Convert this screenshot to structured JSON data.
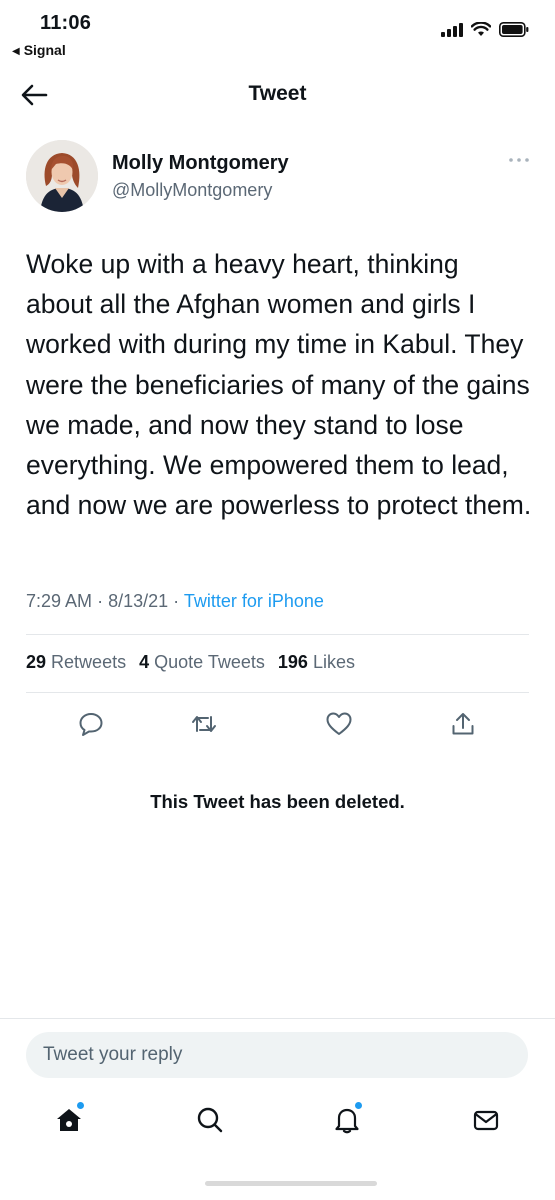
{
  "status_bar": {
    "time": "11:06",
    "back_app_label": "Signal"
  },
  "header": {
    "title": "Tweet"
  },
  "tweet": {
    "author_name": "Molly Montgomery",
    "author_handle": "@MollyMontgomery",
    "text": "Woke up with a heavy heart, thinking about all the Afghan women and girls I worked with during my time in Kabul. They were the beneficiaries of many of the gains we made, and now they stand to lose everything. We empowered them to lead, and now we are powerless to protect them.",
    "time": "7:29 AM",
    "date": "8/13/21",
    "source": "Twitter for iPhone",
    "retweets_count": "29",
    "retweets_label": "Retweets",
    "quotes_count": "4",
    "quotes_label": "Quote Tweets",
    "likes_count": "196",
    "likes_label": "Likes"
  },
  "deleted_notice": "This Tweet has been deleted.",
  "reply": {
    "placeholder": "Tweet your reply"
  },
  "tabbar": {
    "items": [
      "home-icon",
      "search-icon",
      "notifications-icon",
      "messages-icon"
    ]
  },
  "colors": {
    "accent": "#1d9bf0",
    "secondary_text": "#5b6875",
    "divider": "#e4e7ea"
  }
}
